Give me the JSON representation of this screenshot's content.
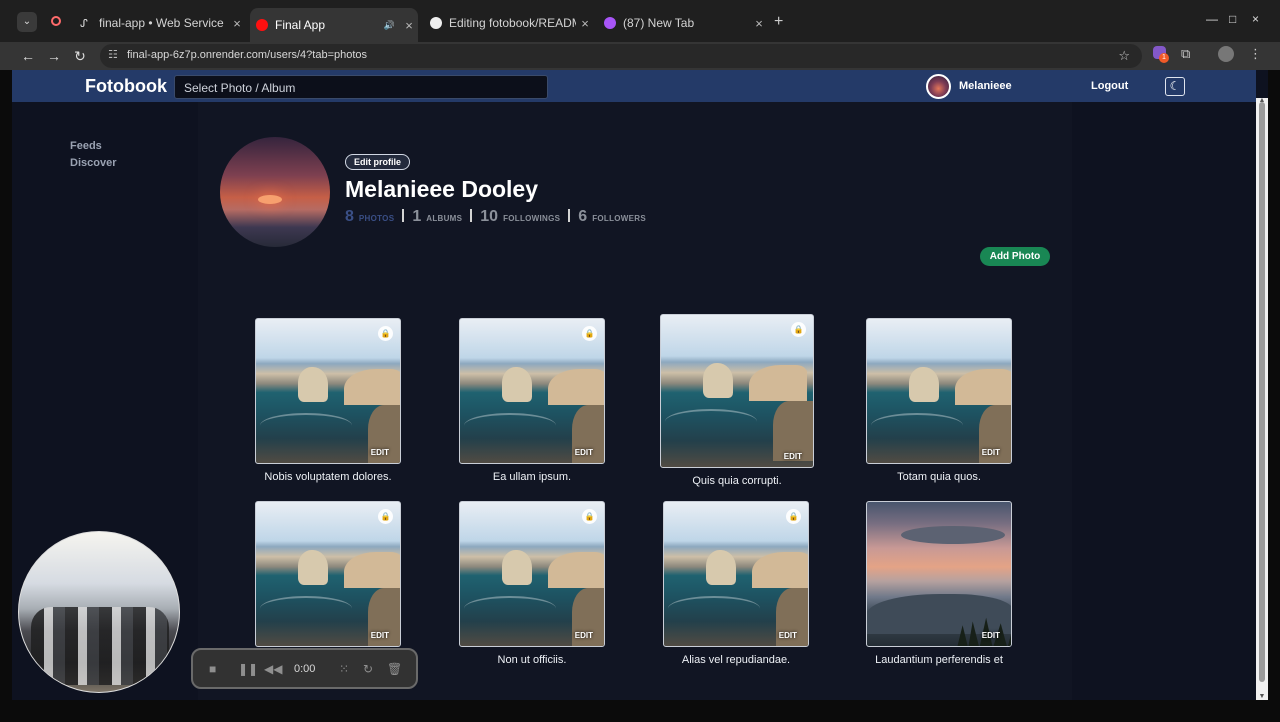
{
  "browser": {
    "tabs": [
      {
        "title": "final-app • Web Service",
        "close": "×"
      },
      {
        "title": "Final App",
        "close": "×",
        "audio": "🔊"
      },
      {
        "title": "Editing fotobook/README",
        "close": "×"
      },
      {
        "title": "(87) New Tab",
        "close": "×"
      }
    ],
    "new_tab": "+",
    "url": "final-app-6z7p.onrender.com/users/4?tab=photos",
    "icons": {
      "tab_list": "chevron-down-icon",
      "back": "arrow-left-icon",
      "forward": "arrow-right-icon",
      "reload": "reload-icon",
      "site_info": "site-settings-icon",
      "bookmark": "star-icon",
      "extension": "puzzle-icon",
      "profile": "avatar",
      "menu": "more-vertical-icon"
    },
    "extension_badge": "1"
  },
  "app": {
    "brand": "Fotobook",
    "search_placeholder": "Select Photo / Album",
    "user_name": "Melanieee",
    "logout_label": "Logout",
    "theme_icon": "moon-icon"
  },
  "sidebar": {
    "items": [
      {
        "label": "Feeds"
      },
      {
        "label": "Discover"
      }
    ]
  },
  "profile": {
    "edit_label": "Edit profile",
    "name": "Melanieee Dooley",
    "stats": [
      {
        "value": "8",
        "label": "PHOTOS"
      },
      {
        "value": "1",
        "label": "ALBUMS"
      },
      {
        "value": "10",
        "label": "FOLLOWINGS"
      },
      {
        "value": "6",
        "label": "FOLLOWERS"
      }
    ],
    "add_photo_label": "Add Photo"
  },
  "photos": [
    {
      "caption": "Nobis voluptatem dolores.",
      "edit_label": "EDIT",
      "private": true
    },
    {
      "caption": "Ea ullam ipsum.",
      "edit_label": "EDIT",
      "private": true
    },
    {
      "caption": "Quis quia corrupti.",
      "edit_label": "EDIT",
      "private": true
    },
    {
      "caption": "Totam quia quos.",
      "edit_label": "EDIT",
      "private": false
    },
    {
      "caption": "",
      "edit_label": "EDIT",
      "private": true
    },
    {
      "caption": "Non ut officiis.",
      "edit_label": "EDIT",
      "private": true
    },
    {
      "caption": "Alias vel repudiandae.",
      "edit_label": "EDIT",
      "private": true
    },
    {
      "caption": "Laudantium perferendis et",
      "edit_label": "EDIT",
      "private": false
    }
  ],
  "recorder": {
    "time": "0:00"
  }
}
